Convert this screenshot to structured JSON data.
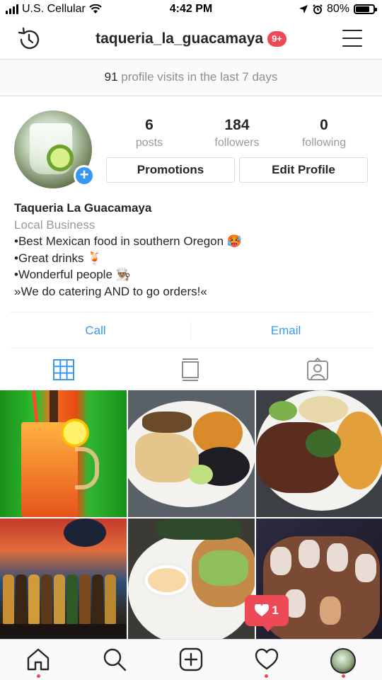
{
  "status_bar": {
    "carrier": "U.S. Cellular",
    "time": "4:42 PM",
    "battery": "80%",
    "battery_level": 0.8
  },
  "header": {
    "username": "taqueria_la_guacamaya",
    "notification_badge": "9+",
    "icons": [
      "history-icon",
      "menu-icon"
    ]
  },
  "visits": {
    "count": "91",
    "text": "profile visits in the last 7 days"
  },
  "profile": {
    "stats": [
      {
        "value": "6",
        "label": "posts"
      },
      {
        "value": "184",
        "label": "followers"
      },
      {
        "value": "0",
        "label": "following"
      }
    ],
    "buttons": {
      "promotions": "Promotions",
      "edit_profile": "Edit Profile"
    },
    "name": "Taqueria La Guacamaya",
    "category": "Local Business",
    "bio_lines": [
      "•Best Mexican food in southern Oregon 🥵",
      "•Great drinks 🍹",
      "•Wonderful people 👨🏽‍🍳",
      "»We do catering AND to go orders!«"
    ]
  },
  "contact": {
    "call": "Call",
    "email": "Email"
  },
  "tabs": [
    "grid-icon",
    "feed-icon",
    "tagged-icon"
  ],
  "activity_popup": {
    "likes": "1"
  },
  "bottom_nav": [
    "home-icon",
    "search-icon",
    "add-icon",
    "heart-icon",
    "profile-icon"
  ],
  "colors": {
    "accent_blue": "#3897f0",
    "notification_red": "#ed4956",
    "text": "#262626",
    "muted": "#999999"
  }
}
